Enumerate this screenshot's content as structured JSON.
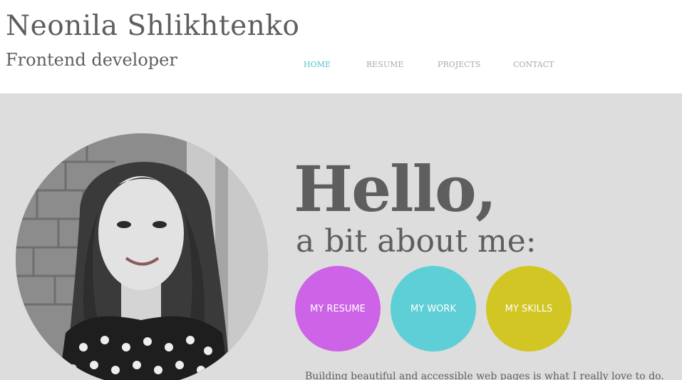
{
  "header": {
    "name": "Neonila Shlikhtenko",
    "role": "Frontend developer"
  },
  "nav": {
    "items": [
      {
        "label": "HOME",
        "active": true
      },
      {
        "label": "RESUME",
        "active": false
      },
      {
        "label": "PROJECTS",
        "active": false
      },
      {
        "label": "CONTACT",
        "active": false
      }
    ]
  },
  "hero": {
    "greeting": "Hello,",
    "subgreeting": "a bit about me:",
    "buttons": [
      {
        "label": "MY RESUME",
        "color": "#cd63e7"
      },
      {
        "label": "MY WORK",
        "color": "#5ecfd6"
      },
      {
        "label": "MY SKILLS",
        "color": "#d1c624"
      }
    ],
    "intro": "Building beautiful and accessible web pages is what I really love to do."
  },
  "colors": {
    "text": "#5e5e5e",
    "nav_active": "#54c1cc",
    "nav_inactive": "#aaaaaa",
    "hero_background": "#dddddd"
  },
  "portrait": {
    "icon": "profile-photo"
  }
}
